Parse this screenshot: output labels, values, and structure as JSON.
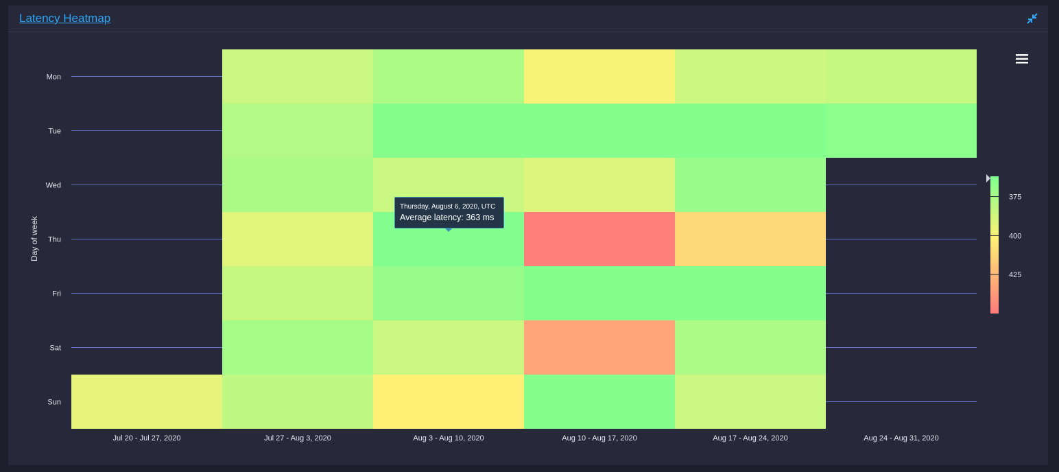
{
  "panel": {
    "title": "Latency Heatmap"
  },
  "tooltip": {
    "date": "Thursday, August 6, 2020, UTC",
    "value": "Average latency: 363 ms"
  },
  "colors": {
    "good": "#7fff8f",
    "mid": "#fff176",
    "bad": "#ff7b7b",
    "grid": "#5f74c8",
    "background": "#272839"
  },
  "chart_data": {
    "type": "heatmap",
    "title": "",
    "ylabel": "Day of week",
    "xlabel": "",
    "x_categories": [
      "Jul 20 - Jul 27, 2020",
      "Jul 27 - Aug 3, 2020",
      "Aug 3 - Aug 10, 2020",
      "Aug 10 - Aug 17, 2020",
      "Aug 17 - Aug 24, 2020",
      "Aug 24 - Aug 31, 2020"
    ],
    "y_categories": [
      "Mon",
      "Tue",
      "Wed",
      "Thu",
      "Fri",
      "Sat",
      "Sun"
    ],
    "unit": "ms",
    "values": [
      [
        null,
        384,
        376,
        398,
        385,
        383
      ],
      [
        null,
        377,
        364,
        364,
        364,
        366
      ],
      [
        null,
        375,
        384,
        390,
        370,
        null
      ],
      [
        null,
        391,
        363,
        448,
        410,
        null
      ],
      [
        null,
        383,
        369,
        364,
        364,
        null
      ],
      [
        null,
        373,
        384,
        432,
        376,
        null
      ],
      [
        393,
        381,
        400,
        364,
        384,
        null
      ]
    ],
    "color_scale": {
      "min": 362,
      "max": 450,
      "ticks": [
        375,
        400,
        425
      ],
      "stops": [
        {
          "value": 362,
          "color": "#7fff8f"
        },
        {
          "value": 400,
          "color": "#fff176"
        },
        {
          "value": 450,
          "color": "#ff7b7b"
        }
      ]
    },
    "legend": "right"
  }
}
